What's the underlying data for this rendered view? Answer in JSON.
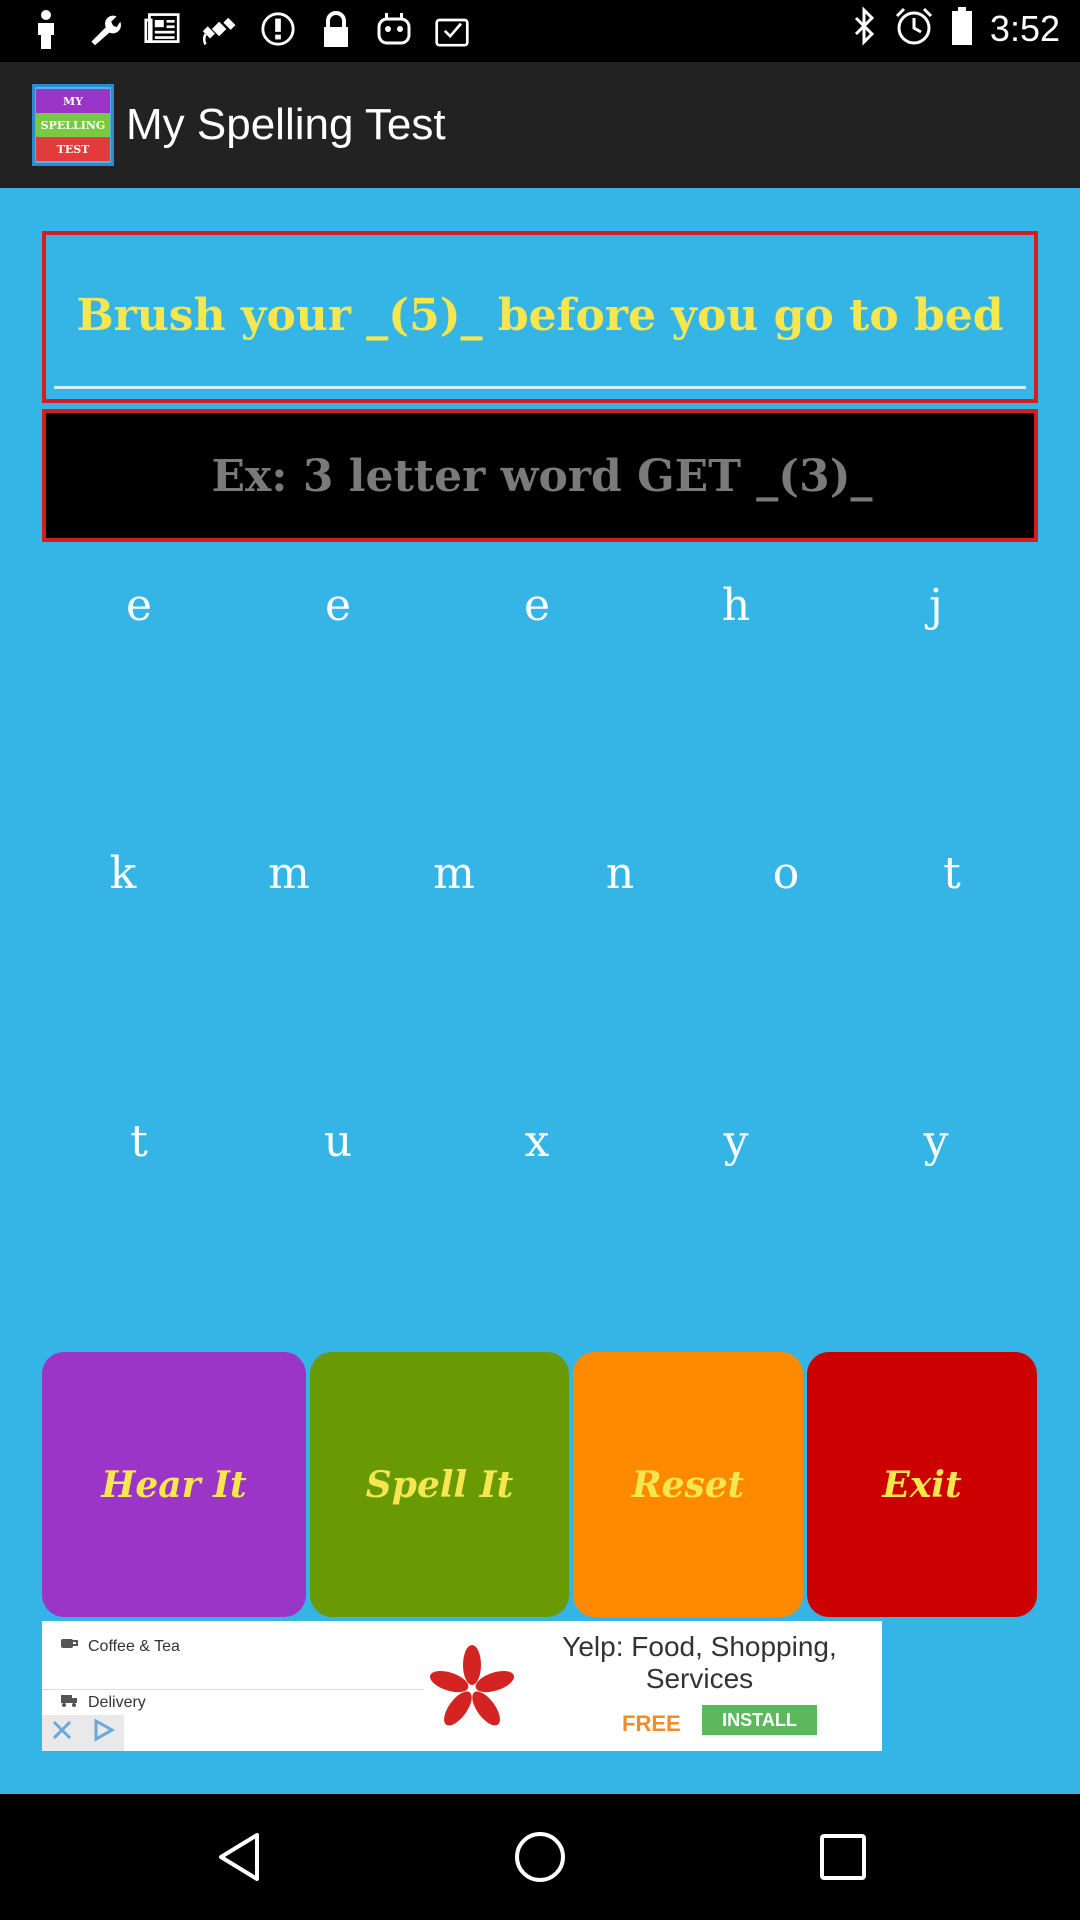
{
  "status_bar": {
    "time": "3:52",
    "left_icons": [
      "person-icon",
      "wrench-icon",
      "news-icon",
      "satellite-icon",
      "circle-icon",
      "lock-icon",
      "android-icon",
      "download-icon"
    ],
    "right_icons": [
      "bluetooth-icon",
      "alarm-icon",
      "battery-icon"
    ]
  },
  "app": {
    "title": "My Spelling Test",
    "logo_lines": [
      "MY",
      "SPELLING",
      "TEST"
    ]
  },
  "sentence": "Brush your _(5)_ before you go to bed",
  "answer_placeholder": "Ex: 3 letter word GET _(3)_",
  "letters": {
    "row1": [
      "e",
      "e",
      "e",
      "h",
      "j"
    ],
    "row2": [
      "k",
      "m",
      "m",
      "n",
      "o",
      "t"
    ],
    "row3": [
      "t",
      "u",
      "x",
      "y",
      "y"
    ]
  },
  "buttons": {
    "hear": "Hear It",
    "spell": "Spell It",
    "reset": "Reset",
    "exit": "Exit"
  },
  "ad": {
    "item1": "Coffee & Tea",
    "item2": "Delivery",
    "title": "Yelp: Food, Shopping, Services",
    "free": "FREE",
    "install": "INSTALL"
  },
  "colors": {
    "background": "#35b5e5",
    "hear": "#9b35c8",
    "spell": "#6a9a03",
    "reset": "#ff8a00",
    "exit": "#cc0000",
    "button_text": "#f6e64f"
  }
}
